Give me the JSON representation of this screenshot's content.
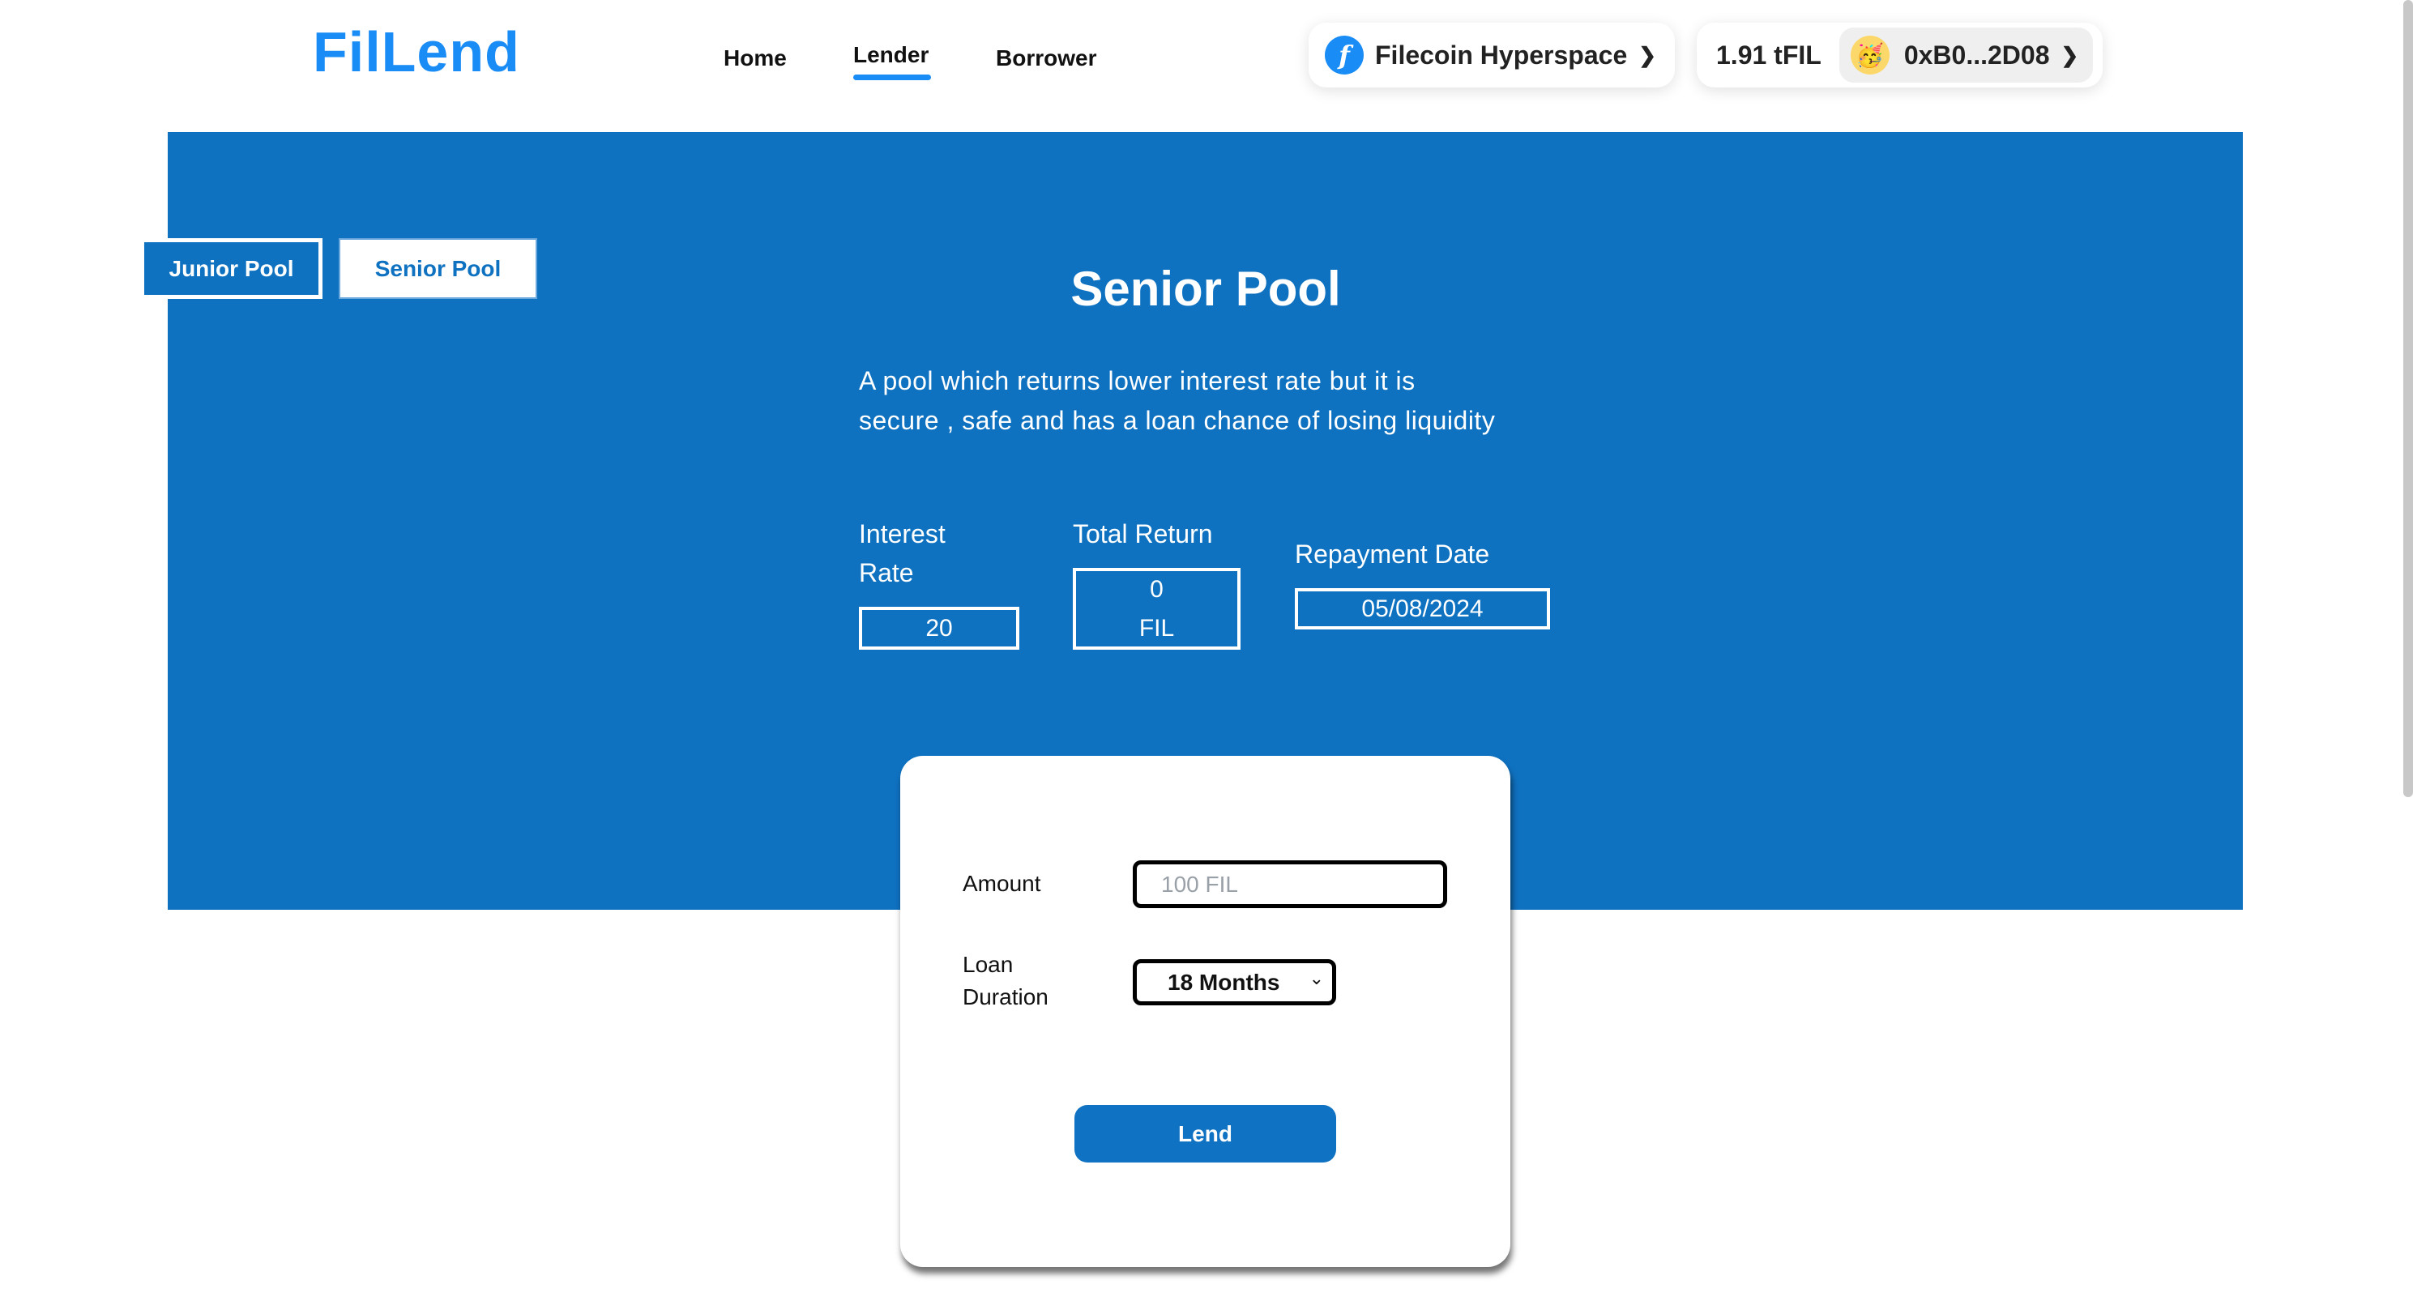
{
  "header": {
    "logo": "FilLend",
    "nav": [
      {
        "label": "Home"
      },
      {
        "label": "Lender",
        "active": true
      },
      {
        "label": "Borrower"
      }
    ],
    "network": {
      "label": "Filecoin Hyperspace",
      "icon": "filecoin-icon"
    },
    "balance": "1.91 tFIL",
    "account": {
      "address": "0xB0...2D08",
      "avatar": "🥳"
    }
  },
  "colors": {
    "brand": "#1a8cf5",
    "banner": "#0f72c1",
    "button": "#1072c2"
  },
  "pool_tabs": [
    {
      "label": "Junior Pool"
    },
    {
      "label": "Senior Pool",
      "selected": true
    }
  ],
  "pool": {
    "title": "Senior Pool",
    "description_line1": "A pool which returns lower interest rate but it is",
    "description_line2": "secure , safe and has a loan chance of losing liquidity",
    "interest_rate_label_1": "Interest",
    "interest_rate_label_2": "Rate",
    "interest_rate": "20",
    "total_return_label": "Total Return",
    "total_return_value": "0",
    "total_return_unit": "FIL",
    "repayment_date_label": "Repayment Date",
    "repayment_date": "05/08/2024"
  },
  "form": {
    "amount_label": "Amount",
    "amount_placeholder": "100 FIL",
    "duration_label_1": "Loan",
    "duration_label_2": "Duration",
    "duration_selected": "18 Months",
    "lend_label": "Lend"
  }
}
